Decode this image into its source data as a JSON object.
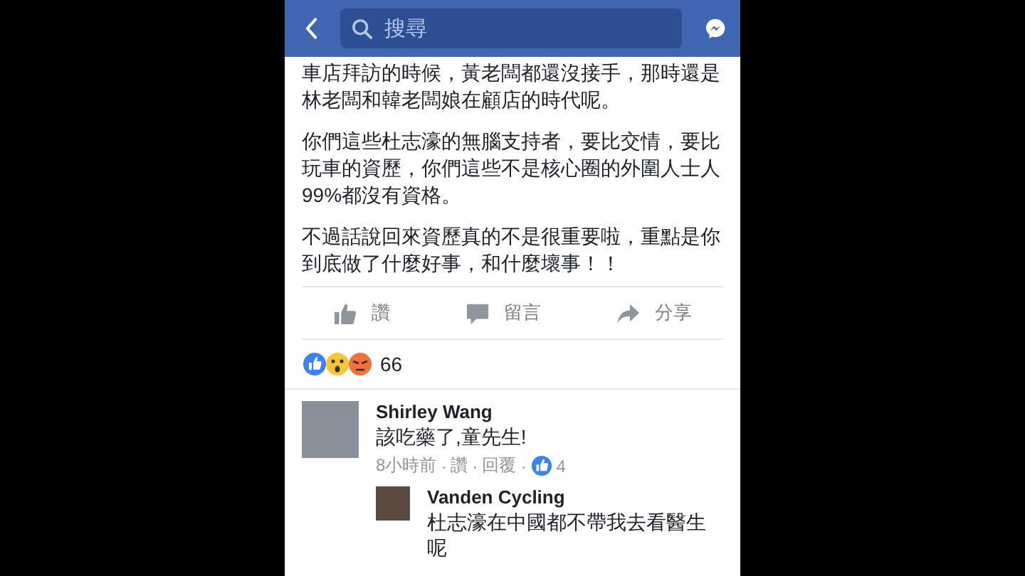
{
  "header": {
    "search_placeholder": "搜尋"
  },
  "post": {
    "paragraphs": [
      "車店拜訪的時候，黃老闆都還沒接手，那時還是林老闆和韓老闆娘在顧店的時代呢。",
      "你們這些杜志濠的無腦支持者，要比交情，要比玩車的資歷，你們這些不是核心圈的外圍人士人99%都沒有資格。",
      "不過話說回來資歷真的不是很重要啦，重點是你到底做了什麼好事，和什麼壞事！！"
    ]
  },
  "actions": [
    {
      "kind": "like",
      "label": "讚"
    },
    {
      "kind": "comment",
      "label": "留言"
    },
    {
      "kind": "share",
      "label": "分享"
    }
  ],
  "reactions": {
    "count": "66"
  },
  "comments": [
    {
      "author": "Shirley Wang",
      "text": "該吃藥了,童先生!",
      "time": "8小時前",
      "separator": "·",
      "like": "讚",
      "reply": "回覆",
      "likes": "4",
      "replies": [
        {
          "author": "Vanden Cycling",
          "text": "杜志濠在中國都不帶我去看醫生呢"
        }
      ]
    }
  ]
}
